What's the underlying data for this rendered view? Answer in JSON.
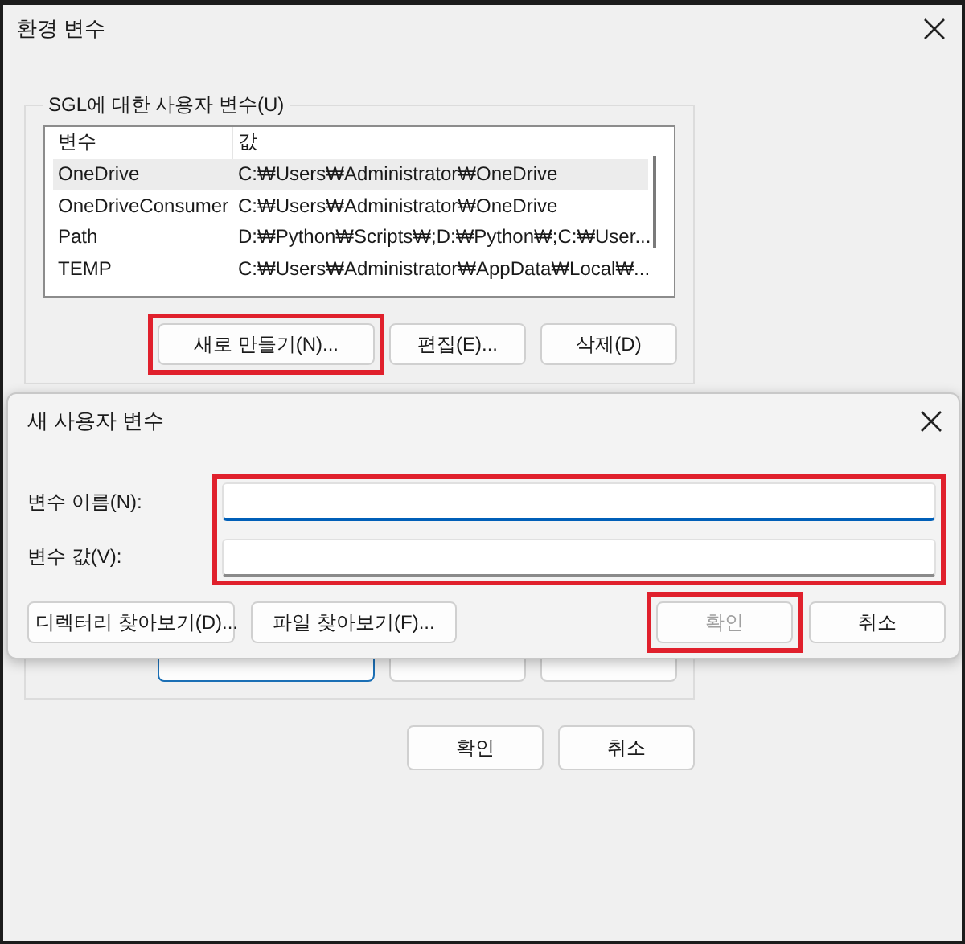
{
  "window": {
    "title": "환경 변수"
  },
  "user_variables": {
    "label": "SGL에 대한 사용자 변수(U)",
    "columns": [
      "변수",
      "값"
    ],
    "rows": [
      {
        "name": "OneDrive",
        "value": "C:₩Users₩Administrator₩OneDrive",
        "selected": true
      },
      {
        "name": "OneDriveConsumer",
        "value": "C:₩Users₩Administrator₩OneDrive",
        "selected": false
      },
      {
        "name": "Path",
        "value": "D:₩Python₩Scripts₩;D:₩Python₩;C:₩User...",
        "selected": false
      },
      {
        "name": "TEMP",
        "value": "C:₩Users₩Administrator₩AppData₩Local₩...",
        "selected": false
      }
    ],
    "buttons": [
      {
        "label": "새로 만들기(N)...",
        "highlighted": true
      },
      {
        "label": "편집(E)...",
        "highlighted": false
      },
      {
        "label": "삭제(D)",
        "highlighted": false
      }
    ]
  },
  "system_variables": {
    "buttons": [
      {
        "focused": true
      },
      {
        "focused": false
      },
      {
        "focused": false
      }
    ]
  },
  "dialog": {
    "title": "새 사용자 변수",
    "fields_highlighted": true,
    "fields": [
      {
        "label": "변수 이름(N):",
        "focused": true
      },
      {
        "label": "변수 값(V):",
        "focused": false
      }
    ],
    "browse_buttons": [
      "디렉터리 찾아보기(D)...",
      "파일 찾아보기(F)..."
    ],
    "buttons": [
      {
        "label": "확인",
        "disabled": true,
        "highlighted": true
      },
      {
        "label": "취소",
        "disabled": false,
        "highlighted": false
      }
    ]
  },
  "buttons": [
    "확인",
    "취소"
  ]
}
